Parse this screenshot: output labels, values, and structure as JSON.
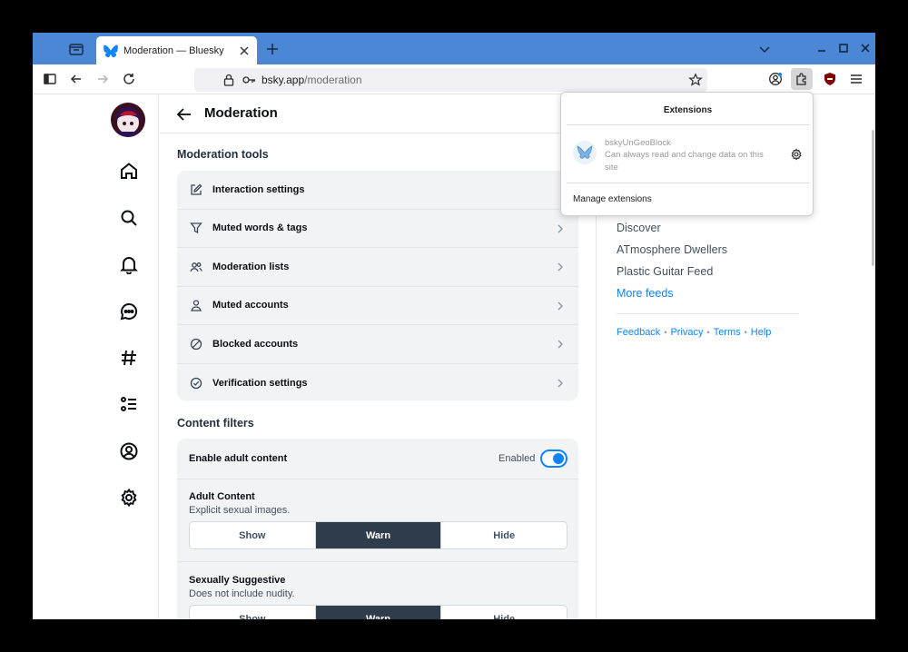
{
  "browser": {
    "tab_title": "Moderation — Bluesky",
    "url_host": "bsky.app",
    "url_path": "/moderation"
  },
  "page": {
    "title": "Moderation"
  },
  "moderation_tools": {
    "heading": "Moderation tools",
    "items": [
      {
        "label": "Interaction settings",
        "icon": "pencil-square-icon"
      },
      {
        "label": "Muted words & tags",
        "icon": "filter-icon"
      },
      {
        "label": "Moderation lists",
        "icon": "people-icon"
      },
      {
        "label": "Muted accounts",
        "icon": "person-icon"
      },
      {
        "label": "Blocked accounts",
        "icon": "blocked-circle-icon"
      },
      {
        "label": "Verification settings",
        "icon": "check-circle-icon"
      }
    ]
  },
  "content_filters": {
    "heading": "Content filters",
    "enable_label": "Enable adult content",
    "enable_status": "Enabled",
    "enabled": true,
    "filters": [
      {
        "title": "Adult Content",
        "description": "Explicit sexual images.",
        "options": [
          "Show",
          "Warn",
          "Hide"
        ],
        "selected": "Warn"
      },
      {
        "title": "Sexually Suggestive",
        "description": "Does not include nudity.",
        "options": [
          "Show",
          "Warn",
          "Hide"
        ],
        "selected": "Warn"
      }
    ]
  },
  "right_sidebar": {
    "feeds": [
      "Discover",
      "ATmosphere Dwellers",
      "Plastic Guitar Feed"
    ],
    "more_feeds": "More feeds",
    "footer": [
      "Feedback",
      "Privacy",
      "Terms",
      "Help"
    ]
  },
  "extensions_popup": {
    "title": "Extensions",
    "extension_name": "bskyUnGeoBlock",
    "extension_desc": "Can always read and change data on this site",
    "manage": "Manage extensions"
  },
  "colors": {
    "tabstrip": "#4b87d4",
    "accent": "#1083fe",
    "segment_active": "#2f3c4c"
  }
}
